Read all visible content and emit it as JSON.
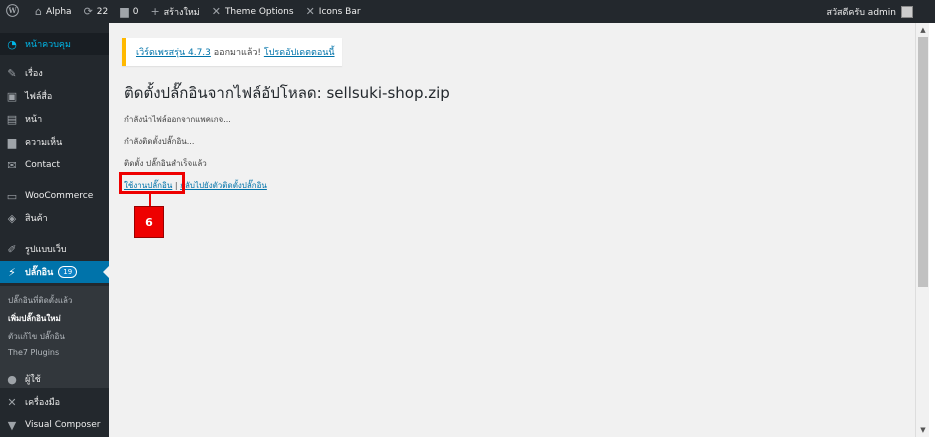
{
  "adminbar": {
    "wp_logo": "wordpress-icon",
    "site_name": "Alpha",
    "updates_count": "22",
    "comments_count": "0",
    "new_label": "สร้างใหม่",
    "theme_options": "Theme Options",
    "icons_bar": "Icons Bar",
    "greeting": "สวัสดีครับ admin"
  },
  "sidebar": {
    "dashboard": "หน้าควบคุม",
    "posts": "เรื่อง",
    "media": "ไฟล์สื่อ",
    "pages": "หน้า",
    "comments": "ความเห็น",
    "contact": "Contact",
    "woocommerce": "WooCommerce",
    "products": "สินค้า",
    "appearance": "รูปแบบเว็บ",
    "plugins": "ปลั๊กอิน",
    "plugins_badge": "19",
    "submenu": {
      "installed": "ปลั๊กอินที่ติดตั้งแล้ว",
      "add_new": "เพิ่มปลั๊กอินใหม่",
      "editor": "ตัวแก้ไข ปลั๊กอิน",
      "the7_plugins": "The7 Plugins"
    },
    "users": "ผู้ใช้",
    "tools": "เครื่องมือ",
    "visual_composer": "Visual Composer"
  },
  "notice": {
    "version_link": "เวิร์ดเพรสรุ่น 4.7.3",
    "text": " ออกมาแล้ว! ",
    "update_link": "โปรดอัปเดตตอนนี้"
  },
  "main": {
    "title": "ติดตั้งปลั๊กอินจากไฟล์อัปโหลด: sellsuki-shop.zip",
    "line1": "กำลังนำไฟล์ออกจากแพคเกจ...",
    "line2": "กำลังติดตั้งปลั๊กอิน...",
    "line3": "ติดตั้ง ปลั๊กอินสำเร็จแล้ว",
    "activate_link": "ใช้งานปลั๊กอิน",
    "separator": " | ",
    "return_link": "กลับไปยังตัวติดตั้งปลั๊กอิน"
  },
  "annotation": {
    "step": "6",
    "color": "#e00000"
  }
}
